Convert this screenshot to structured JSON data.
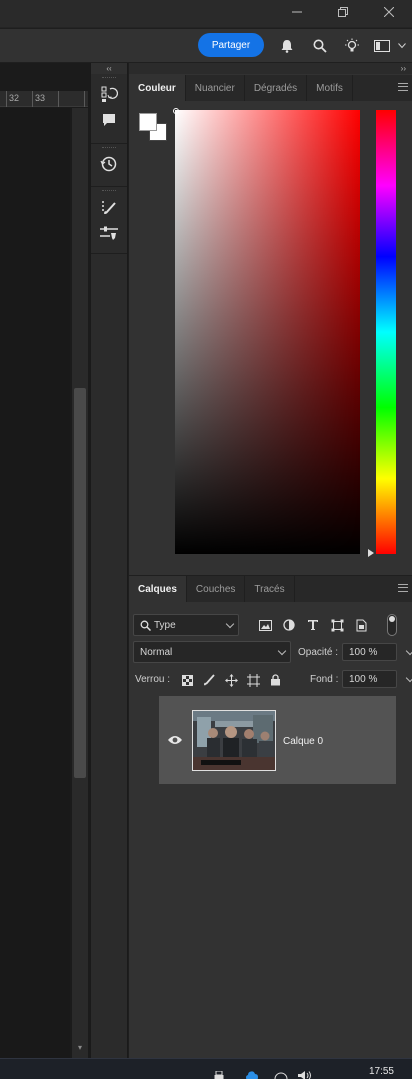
{
  "share_button": "Partager",
  "ruler": {
    "labels": [
      "32",
      "33"
    ]
  },
  "color_panel": {
    "tabs": [
      "Couleur",
      "Nuancier",
      "Dégradés",
      "Motifs"
    ],
    "active_tab": "Couleur",
    "foreground_color": "#ffffff",
    "background_color": "#ffffff",
    "hue": "#ff0000"
  },
  "layers_panel": {
    "tabs": [
      "Calques",
      "Couches",
      "Tracés"
    ],
    "active_tab": "Calques",
    "filter_kind": "Type",
    "blend_mode": "Normal",
    "opacity_label": "Opacité :",
    "opacity_value": "100 %",
    "lock_label": "Verrou :",
    "fill_label": "Fond :",
    "fill_value": "100 %",
    "layers": [
      {
        "name": "Calque 0",
        "visible": true
      }
    ]
  },
  "taskbar": {
    "time": "17:55"
  },
  "icons": {
    "titlebar": [
      "minimize-icon",
      "restore-icon",
      "close-icon"
    ],
    "options": [
      "bell-icon",
      "search-icon",
      "lightbulb-icon",
      "workspace-icon"
    ],
    "tools": [
      "properties-icon",
      "comment-icon",
      "history-icon",
      "brush-settings-icon",
      "adjust-brush-icon"
    ],
    "layer_filters": [
      "image-filter-icon",
      "adjustment-filter-icon",
      "text-filter-icon",
      "shape-filter-icon",
      "smart-object-filter-icon"
    ],
    "locks": [
      "lock-pixels-icon",
      "lock-image-icon",
      "lock-position-icon",
      "lock-artboard-icon",
      "lock-all-icon"
    ]
  },
  "colors": {
    "accent": "#1473e6"
  }
}
